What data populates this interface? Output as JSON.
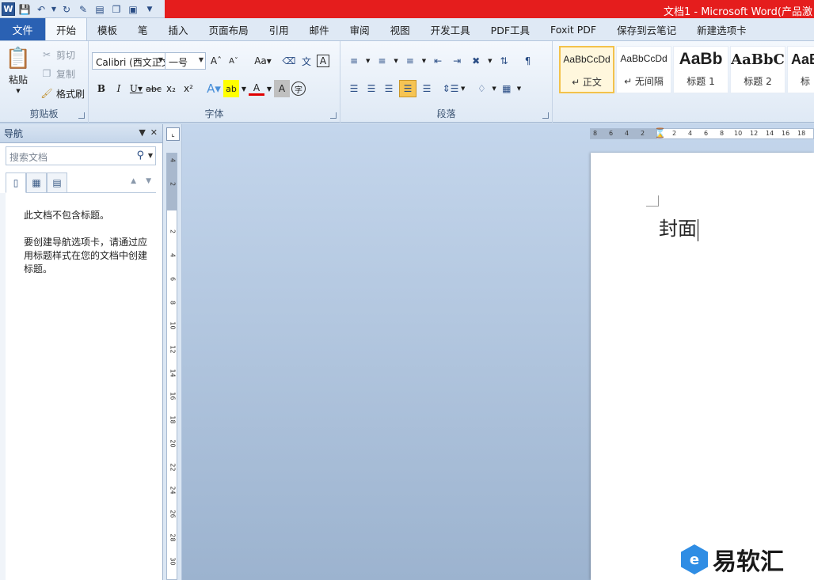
{
  "titlebar": {
    "title": "文档1 - Microsoft Word(产品激"
  },
  "tabs": {
    "file": "文件",
    "items": [
      "开始",
      "模板",
      "笔",
      "插入",
      "页面布局",
      "引用",
      "邮件",
      "审阅",
      "视图",
      "开发工具",
      "PDF工具",
      "Foxit PDF",
      "保存到云笔记",
      "新建选项卡"
    ],
    "active": "开始"
  },
  "clipboard": {
    "paste": "粘贴",
    "cut": "剪切",
    "copy": "复制",
    "format_painter": "格式刷",
    "label": "剪贴板"
  },
  "font": {
    "name": "Calibri (西文正文)",
    "size": "一号",
    "label": "字体"
  },
  "paragraph": {
    "label": "段落"
  },
  "styles": [
    {
      "sample": "AaBbCcDd",
      "name": "↵ 正文"
    },
    {
      "sample": "AaBbCcDd",
      "name": "↵ 无间隔"
    },
    {
      "sample": "AaBb",
      "name": "标题 1"
    },
    {
      "sample": "AaBbC",
      "name": "标题 2"
    },
    {
      "sample": "AaB",
      "name": "标"
    }
  ],
  "nav": {
    "title": "导航",
    "search_placeholder": "搜索文档",
    "line1": "此文档不包含标题。",
    "line2": "要创建导航选项卡，请通过应用标题样式在您的文档中创建标题。"
  },
  "document": {
    "text": "封面"
  },
  "vruler_ticks": [
    "4",
    "2",
    "2",
    "4",
    "6",
    "8",
    "10",
    "12",
    "14",
    "16",
    "18",
    "20",
    "22",
    "24",
    "26",
    "28",
    "30"
  ],
  "hruler_ticks": [
    "8",
    "6",
    "4",
    "2",
    "2",
    "4",
    "6",
    "8",
    "10",
    "12",
    "14",
    "16",
    "18"
  ],
  "watermark": {
    "text": "易软汇"
  }
}
